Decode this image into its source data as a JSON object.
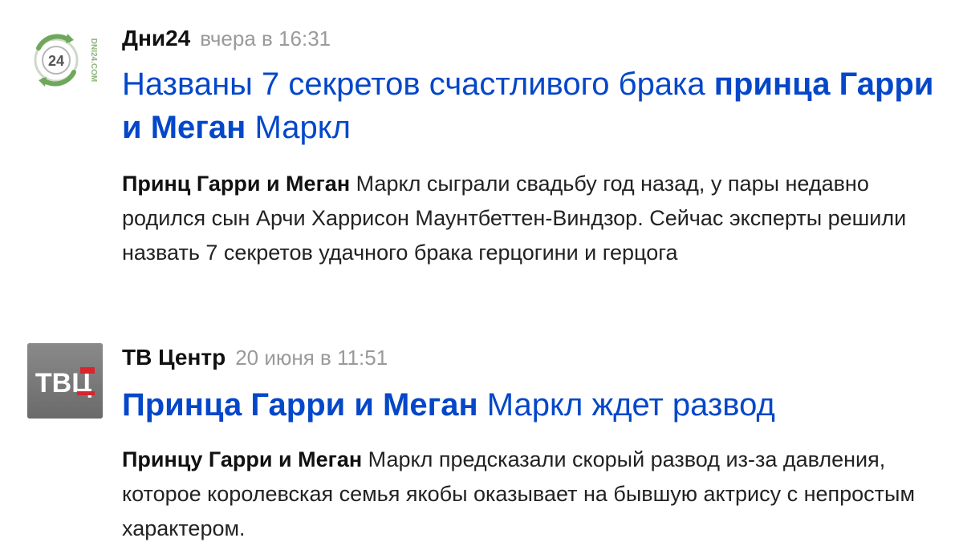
{
  "items": [
    {
      "source": "Дни24",
      "time": "вчера в 16:31",
      "logo": {
        "icon": "dni24-logo",
        "text": "24",
        "side_text": "DNI24.COM",
        "color": "#5f9a4a"
      },
      "headline": {
        "pre": "Названы 7 секретов счастливого брака ",
        "bold": "принца Гарри и Меган",
        "post": " Маркл"
      },
      "snippet": {
        "bold": "Принц Гарри и Меган",
        "rest": " Маркл сыграли свадьбу год назад, у пары недавно родился сын Арчи Харрисон Маунтбеттен-Виндзор. Сейчас эксперты решили назвать 7 секретов удачного брака герцогини и герцога"
      }
    },
    {
      "source": "ТВ Центр",
      "time": "20 июня в 11:51",
      "logo": {
        "icon": "tvc-logo",
        "text": "ТВЦ",
        "background": "#7a7a7a",
        "accent": "#d9232d"
      },
      "headline": {
        "pre": "",
        "bold": "Принца Гарри и Меган",
        "post": " Маркл ждет развод"
      },
      "snippet": {
        "bold": "Принцу Гарри и Меган",
        "rest": " Маркл предсказали скорый развод из-за давления, которое королевская семья якобы оказывает на бывшую актрису с непростым характером."
      }
    }
  ],
  "colors": {
    "headline": "#0447c9",
    "time": "#9a9a9a",
    "text": "#222222"
  }
}
